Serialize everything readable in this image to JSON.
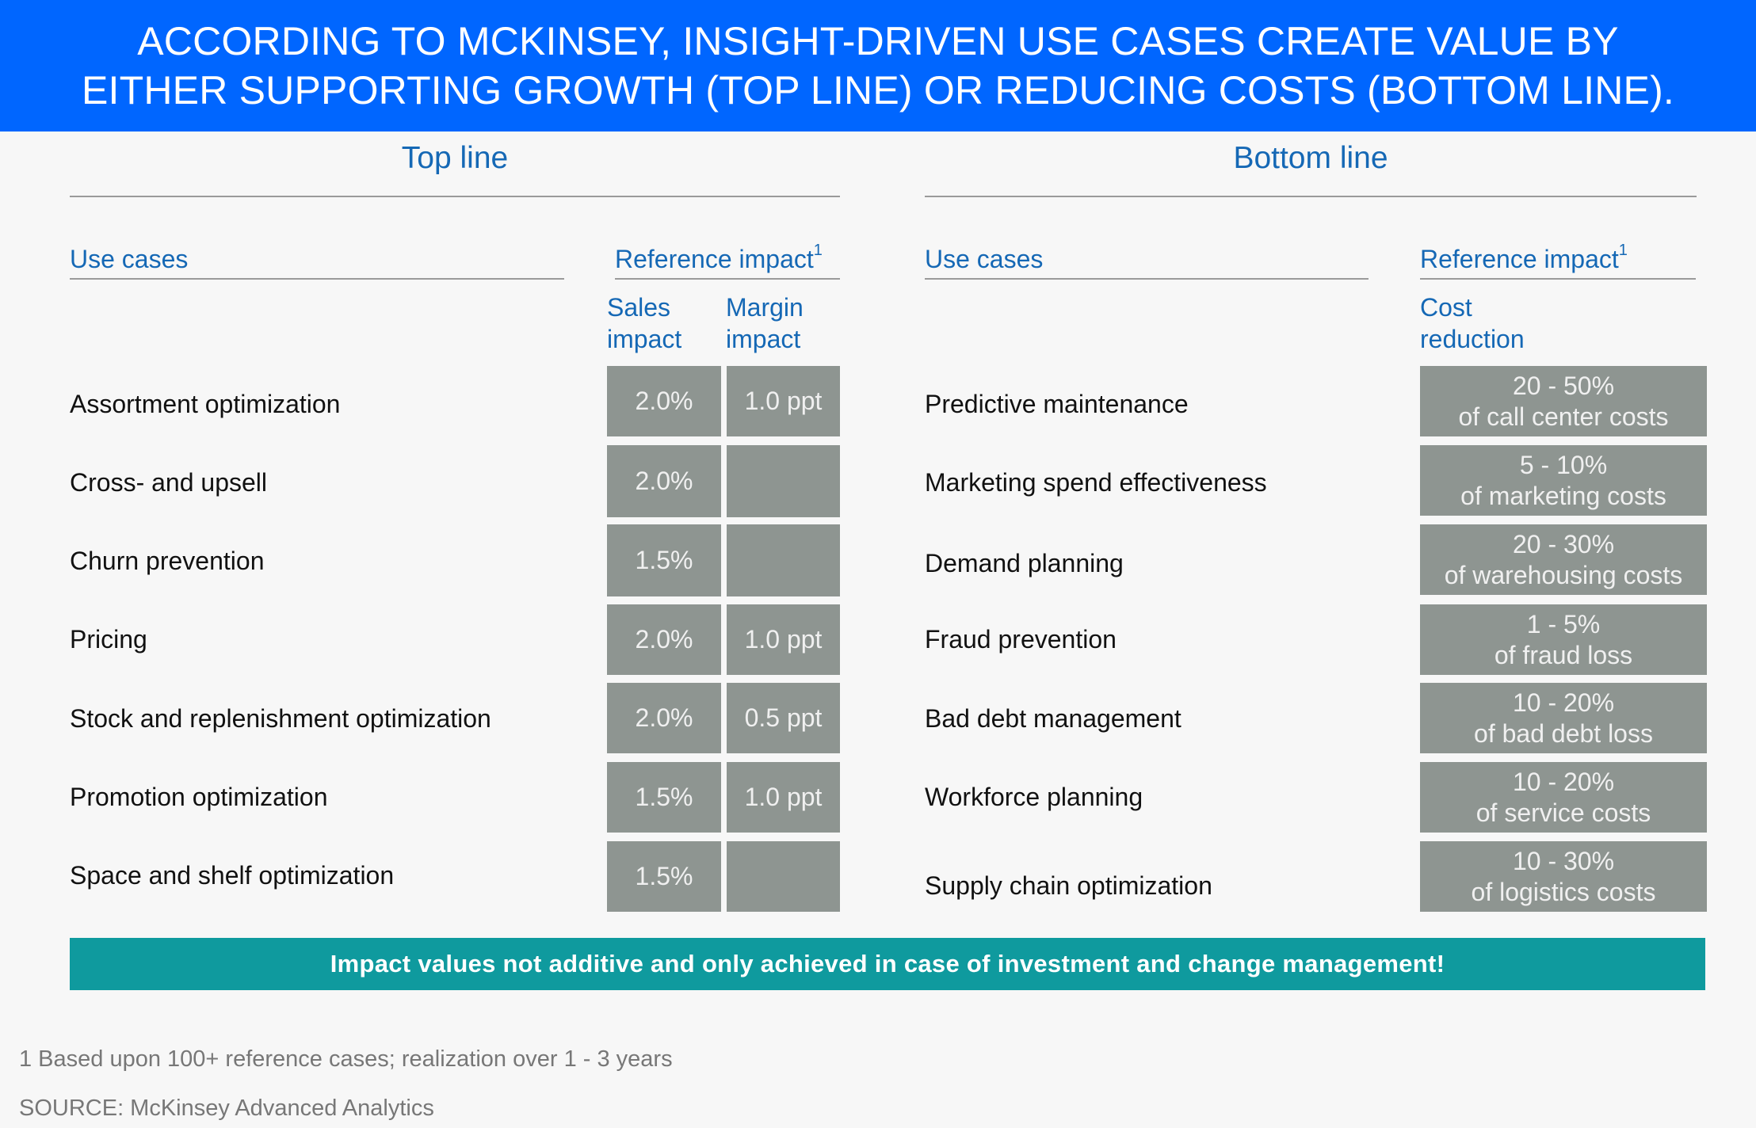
{
  "banner": {
    "line1": "ACCORDING TO MCKINSEY, INSIGHT-DRIVEN USE CASES CREATE VALUE BY",
    "line2": "EITHER SUPPORTING GROWTH (TOP LINE) OR REDUCING COSTS (BOTTOM LINE)."
  },
  "top_line": {
    "title": "Top line",
    "use_cases_header": "Use cases",
    "impact_header": "Reference impact",
    "impact_footnote_mark": "1",
    "sales_header": [
      "Sales",
      "impact"
    ],
    "margin_header": [
      "Margin",
      "impact"
    ],
    "rows": [
      {
        "label": "Assortment optimization",
        "sales": "2.0%",
        "margin": "1.0 ppt"
      },
      {
        "label": "Cross- and upsell",
        "sales": "2.0%",
        "margin": ""
      },
      {
        "label": "Churn prevention",
        "sales": "1.5%",
        "margin": ""
      },
      {
        "label": "Pricing",
        "sales": "2.0%",
        "margin": "1.0 ppt"
      },
      {
        "label": "Stock and replenishment optimization",
        "sales": "2.0%",
        "margin": "0.5 ppt"
      },
      {
        "label": "Promotion optimization",
        "sales": "1.5%",
        "margin": "1.0 ppt"
      },
      {
        "label": "Space and shelf optimization",
        "sales": "1.5%",
        "margin": ""
      }
    ]
  },
  "bottom_line": {
    "title": "Bottom line",
    "use_cases_header": "Use cases",
    "impact_header": "Reference impact",
    "impact_footnote_mark": "1",
    "cost_header": [
      "Cost",
      "reduction"
    ],
    "rows": [
      {
        "label": "Predictive maintenance",
        "range": "20 - 50%",
        "basis": "of call center costs"
      },
      {
        "label": "Marketing spend effectiveness",
        "range": "5 - 10%",
        "basis": "of marketing costs"
      },
      {
        "label": "Demand planning",
        "range": "20 - 30%",
        "basis": "of warehousing costs"
      },
      {
        "label": "Fraud prevention",
        "range": "1 - 5%",
        "basis": "of fraud loss"
      },
      {
        "label": "Bad debt management",
        "range": "10 - 20%",
        "basis": "of bad debt loss"
      },
      {
        "label": "Workforce planning",
        "range": "10 - 20%",
        "basis": "of service costs"
      },
      {
        "label": "Supply chain optimization",
        "range": "10 - 30%",
        "basis": "of logistics costs"
      }
    ]
  },
  "note": "Impact values not additive and only achieved in case of investment and change management!",
  "footnote": "1 Based upon 100+ reference cases; realization over 1 - 3 years",
  "source": "SOURCE: McKinsey Advanced Analytics",
  "colors": {
    "banner": "#0066ff",
    "accent_text": "#1568b5",
    "cell": "#8e9591",
    "note_bar": "#0f9a9e"
  }
}
